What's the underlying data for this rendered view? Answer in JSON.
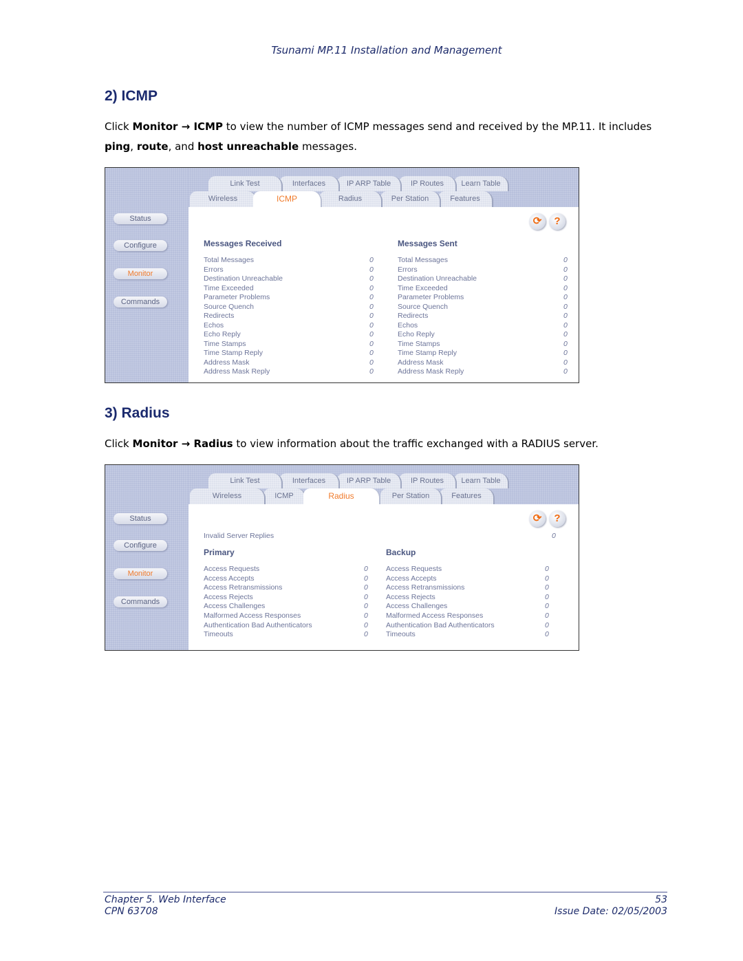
{
  "running_header": "Tsunami MP.11 Installation and Management",
  "icmp_section": {
    "heading": "2) ICMP",
    "para_parts": {
      "p1": "Click ",
      "b1": "Monitor → ICMP",
      "p2": " to view the number of ICMP messages send and received by the MP.11.  It includes ",
      "b2": "ping",
      "p3": ", ",
      "b3": "route",
      "p4": ", and ",
      "b4": "host unreachable",
      "p5": " messages."
    }
  },
  "radius_section": {
    "heading": "3) Radius",
    "para_parts": {
      "p1": "Click ",
      "b1": "Monitor → Radius",
      "p2": " to view information about the traffic exchanged with a RADIUS server."
    }
  },
  "ui": {
    "nav": [
      "Status",
      "Configure",
      "Monitor",
      "Commands"
    ],
    "active_nav": "Monitor",
    "tabs_row1": [
      "Link Test",
      "Interfaces",
      "IP ARP Table",
      "IP Routes",
      "Learn Table"
    ],
    "tabs_row2": [
      "Wireless",
      "ICMP",
      "Radius",
      "Per Station",
      "Features"
    ],
    "icons": {
      "refresh": "refresh-icon",
      "help": "help-icon"
    },
    "accent_color": "#f07a2a"
  },
  "icmp_screen": {
    "active_tab": "ICMP",
    "received": {
      "title": "Messages Received",
      "rows": [
        {
          "label": "Total Messages",
          "value": "0"
        },
        {
          "label": "Errors",
          "value": "0"
        },
        {
          "label": "Destination Unreachable",
          "value": "0"
        },
        {
          "label": "Time Exceeded",
          "value": "0"
        },
        {
          "label": "Parameter Problems",
          "value": "0"
        },
        {
          "label": "Source Quench",
          "value": "0"
        },
        {
          "label": "Redirects",
          "value": "0"
        },
        {
          "label": "Echos",
          "value": "0"
        },
        {
          "label": "Echo Reply",
          "value": "0"
        },
        {
          "label": "Time Stamps",
          "value": "0"
        },
        {
          "label": "Time Stamp Reply",
          "value": "0"
        },
        {
          "label": "Address Mask",
          "value": "0"
        },
        {
          "label": "Address Mask Reply",
          "value": "0"
        }
      ]
    },
    "sent": {
      "title": "Messages Sent",
      "rows": [
        {
          "label": "Total Messages",
          "value": "0"
        },
        {
          "label": "Errors",
          "value": "0"
        },
        {
          "label": "Destination Unreachable",
          "value": "0"
        },
        {
          "label": "Time Exceeded",
          "value": "0"
        },
        {
          "label": "Parameter Problems",
          "value": "0"
        },
        {
          "label": "Source Quench",
          "value": "0"
        },
        {
          "label": "Redirects",
          "value": "0"
        },
        {
          "label": "Echos",
          "value": "0"
        },
        {
          "label": "Echo Reply",
          "value": "0"
        },
        {
          "label": "Time Stamps",
          "value": "0"
        },
        {
          "label": "Time Stamp Reply",
          "value": "0"
        },
        {
          "label": "Address Mask",
          "value": "0"
        },
        {
          "label": "Address Mask Reply",
          "value": "0"
        }
      ]
    }
  },
  "radius_screen": {
    "active_tab": "Radius",
    "invalid_server_replies": {
      "label": "Invalid Server Replies",
      "value": "0"
    },
    "primary": {
      "title": "Primary",
      "rows": [
        {
          "label": "Access Requests",
          "value": "0"
        },
        {
          "label": "Access Accepts",
          "value": "0"
        },
        {
          "label": "Access Retransmissions",
          "value": "0"
        },
        {
          "label": "Access Rejects",
          "value": "0"
        },
        {
          "label": "Access Challenges",
          "value": "0"
        },
        {
          "label": "Malformed Access Responses",
          "value": "0"
        },
        {
          "label": "Authentication Bad Authenticators",
          "value": "0"
        },
        {
          "label": "Timeouts",
          "value": "0"
        }
      ]
    },
    "backup": {
      "title": "Backup",
      "rows": [
        {
          "label": "Access Requests",
          "value": "0"
        },
        {
          "label": "Access Accepts",
          "value": "0"
        },
        {
          "label": "Access Retransmissions",
          "value": "0"
        },
        {
          "label": "Access Rejects",
          "value": "0"
        },
        {
          "label": "Access Challenges",
          "value": "0"
        },
        {
          "label": "Malformed Access Responses",
          "value": "0"
        },
        {
          "label": "Authentication Bad Authenticators",
          "value": "0"
        },
        {
          "label": "Timeouts",
          "value": "0"
        }
      ]
    }
  },
  "footer": {
    "chapter": "Chapter 5.  Web Interface",
    "page": "53",
    "cpn": "CPN 63708",
    "issue_date": "Issue Date:  02/05/2003"
  }
}
